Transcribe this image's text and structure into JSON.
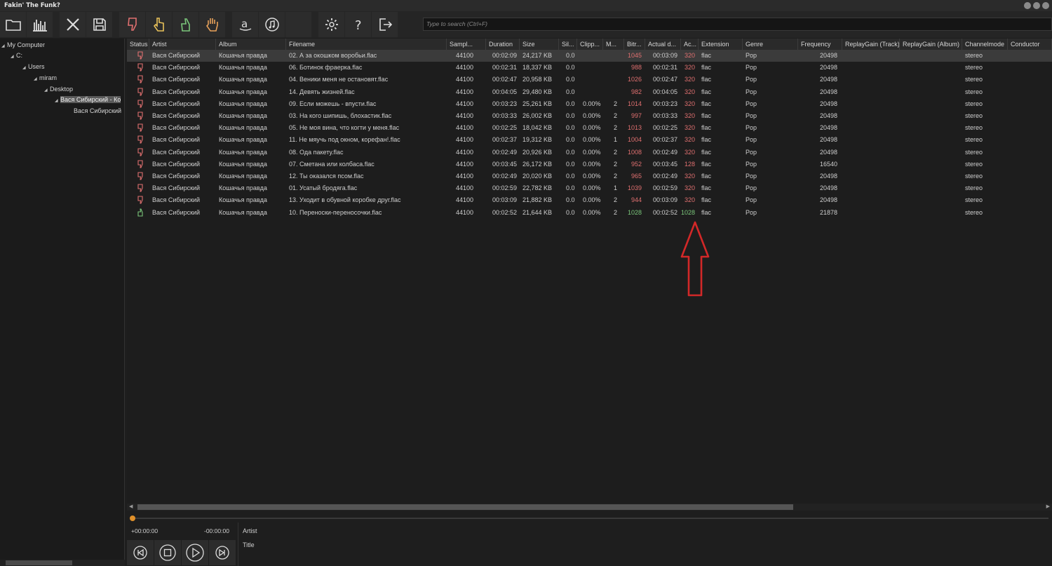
{
  "window": {
    "title": "Fakin' The Funk?"
  },
  "search": {
    "placeholder": "Type to search (Ctrl+F)"
  },
  "tree": [
    {
      "label": "My Computer"
    },
    {
      "label": "C:"
    },
    {
      "label": "Users"
    },
    {
      "label": "miram"
    },
    {
      "label": "Desktop"
    },
    {
      "label": "Вася Сибирский - Ко"
    },
    {
      "label": "Вася Сибирский"
    }
  ],
  "columns": [
    "Status",
    "Artist",
    "Album",
    "Filename",
    "Sampl...",
    "Duration",
    "Size",
    "Sil...",
    "Clipp...",
    "M...",
    "Bitr...",
    "Actual d...",
    "Ac...",
    "Extension",
    "Genre",
    "Frequency",
    "ReplayGain (Track)",
    "ReplayGain (Album)",
    "Channelmode",
    "Conductor"
  ],
  "rows": [
    {
      "status": "thumbs-down",
      "artist": "Вася Сибирский",
      "album": "Кошачья правда",
      "filename": "02. А за окошком воробьи.flac",
      "sample": "44100",
      "duration": "00:02:09",
      "size": "24,217 KB",
      "sil": "0.0",
      "clip": "",
      "m": "",
      "bitrate": "1045",
      "actual": "00:03:09",
      "ac": "320",
      "ext": "flac",
      "genre": "Pop",
      "freq": "20498",
      "channel": "stereo"
    },
    {
      "status": "thumbs-down",
      "artist": "Вася Сибирский",
      "album": "Кошачья правда",
      "filename": "06. Ботинок фраерка.flac",
      "sample": "44100",
      "duration": "00:02:31",
      "size": "18,337 KB",
      "sil": "0.0",
      "clip": "",
      "m": "",
      "bitrate": "988",
      "actual": "00:02:31",
      "ac": "320",
      "ext": "flac",
      "genre": "Pop",
      "freq": "20498",
      "channel": "stereo"
    },
    {
      "status": "thumbs-down",
      "artist": "Вася Сибирский",
      "album": "Кошачья правда",
      "filename": "04. Веники меня не остановят.flac",
      "sample": "44100",
      "duration": "00:02:47",
      "size": "20,958 KB",
      "sil": "0.0",
      "clip": "",
      "m": "",
      "bitrate": "1026",
      "actual": "00:02:47",
      "ac": "320",
      "ext": "flac",
      "genre": "Pop",
      "freq": "20498",
      "channel": "stereo"
    },
    {
      "status": "thumbs-down",
      "artist": "Вася Сибирский",
      "album": "Кошачья правда",
      "filename": "14. Девять жизней.flac",
      "sample": "44100",
      "duration": "00:04:05",
      "size": "29,480 KB",
      "sil": "0.0",
      "clip": "",
      "m": "",
      "bitrate": "982",
      "actual": "00:04:05",
      "ac": "320",
      "ext": "flac",
      "genre": "Pop",
      "freq": "20498",
      "channel": "stereo"
    },
    {
      "status": "thumbs-down",
      "artist": "Вася Сибирский",
      "album": "Кошачья правда",
      "filename": "09. Если можешь - впусти.flac",
      "sample": "44100",
      "duration": "00:03:23",
      "size": "25,261 KB",
      "sil": "0.0",
      "clip": "0.00%",
      "m": "2",
      "bitrate": "1014",
      "actual": "00:03:23",
      "ac": "320",
      "ext": "flac",
      "genre": "Pop",
      "freq": "20498",
      "channel": "stereo"
    },
    {
      "status": "thumbs-down",
      "artist": "Вася Сибирский",
      "album": "Кошачья правда",
      "filename": "03. На кого шипишь, блохастик.flac",
      "sample": "44100",
      "duration": "00:03:33",
      "size": "26,002 KB",
      "sil": "0.0",
      "clip": "0.00%",
      "m": "2",
      "bitrate": "997",
      "actual": "00:03:33",
      "ac": "320",
      "ext": "flac",
      "genre": "Pop",
      "freq": "20498",
      "channel": "stereo"
    },
    {
      "status": "thumbs-down",
      "artist": "Вася Сибирский",
      "album": "Кошачья правда",
      "filename": "05. Не моя вина, что когти у меня.flac",
      "sample": "44100",
      "duration": "00:02:25",
      "size": "18,042 KB",
      "sil": "0.0",
      "clip": "0.00%",
      "m": "2",
      "bitrate": "1013",
      "actual": "00:02:25",
      "ac": "320",
      "ext": "flac",
      "genre": "Pop",
      "freq": "20498",
      "channel": "stereo"
    },
    {
      "status": "thumbs-down",
      "artist": "Вася Сибирский",
      "album": "Кошачья правда",
      "filename": "11. Не мяучь под окном, корефан!.flac",
      "sample": "44100",
      "duration": "00:02:37",
      "size": "19,312 KB",
      "sil": "0.0",
      "clip": "0.00%",
      "m": "1",
      "bitrate": "1004",
      "actual": "00:02:37",
      "ac": "320",
      "ext": "flac",
      "genre": "Pop",
      "freq": "20498",
      "channel": "stereo"
    },
    {
      "status": "thumbs-down",
      "artist": "Вася Сибирский",
      "album": "Кошачья правда",
      "filename": "08. Ода пакету.flac",
      "sample": "44100",
      "duration": "00:02:49",
      "size": "20,926 KB",
      "sil": "0.0",
      "clip": "0.00%",
      "m": "2",
      "bitrate": "1008",
      "actual": "00:02:49",
      "ac": "320",
      "ext": "flac",
      "genre": "Pop",
      "freq": "20498",
      "channel": "stereo"
    },
    {
      "status": "thumbs-down",
      "artist": "Вася Сибирский",
      "album": "Кошачья правда",
      "filename": "07. Сметана или колбаса.flac",
      "sample": "44100",
      "duration": "00:03:45",
      "size": "26,172 KB",
      "sil": "0.0",
      "clip": "0.00%",
      "m": "2",
      "bitrate": "952",
      "actual": "00:03:45",
      "ac": "128",
      "ext": "flac",
      "genre": "Pop",
      "freq": "16540",
      "channel": "stereo"
    },
    {
      "status": "thumbs-down",
      "artist": "Вася Сибирский",
      "album": "Кошачья правда",
      "filename": "12. Ты оказался псом.flac",
      "sample": "44100",
      "duration": "00:02:49",
      "size": "20,020 KB",
      "sil": "0.0",
      "clip": "0.00%",
      "m": "2",
      "bitrate": "965",
      "actual": "00:02:49",
      "ac": "320",
      "ext": "flac",
      "genre": "Pop",
      "freq": "20498",
      "channel": "stereo"
    },
    {
      "status": "thumbs-down",
      "artist": "Вася Сибирский",
      "album": "Кошачья правда",
      "filename": "01. Усатый бродяга.flac",
      "sample": "44100",
      "duration": "00:02:59",
      "size": "22,782 KB",
      "sil": "0.0",
      "clip": "0.00%",
      "m": "1",
      "bitrate": "1039",
      "actual": "00:02:59",
      "ac": "320",
      "ext": "flac",
      "genre": "Pop",
      "freq": "20498",
      "channel": "stereo"
    },
    {
      "status": "thumbs-down",
      "artist": "Вася Сибирский",
      "album": "Кошачья правда",
      "filename": "13. Уходит в обувной коробке друг.flac",
      "sample": "44100",
      "duration": "00:03:09",
      "size": "21,882 KB",
      "sil": "0.0",
      "clip": "0.00%",
      "m": "2",
      "bitrate": "944",
      "actual": "00:03:09",
      "ac": "320",
      "ext": "flac",
      "genre": "Pop",
      "freq": "20498",
      "channel": "stereo"
    },
    {
      "status": "thumbs-up",
      "artist": "Вася Сибирский",
      "album": "Кошачья правда",
      "filename": "10. Переноски-переносочки.flac",
      "sample": "44100",
      "duration": "00:02:52",
      "size": "21,644 KB",
      "sil": "0.0",
      "clip": "0.00%",
      "m": "2",
      "bitrate": "1028",
      "actual": "00:02:52",
      "ac": "1028",
      "ext": "flac",
      "genre": "Pop",
      "freq": "21878",
      "channel": "stereo"
    }
  ],
  "player": {
    "elapsed": "+00:00:00",
    "remaining": "-00:00:00",
    "artist_label": "Artist",
    "title_label": "Title"
  },
  "colors": {
    "bad": "#e07070",
    "good": "#7bc77b",
    "annotation": "#d22828",
    "seek_knob": "#e0902a"
  }
}
